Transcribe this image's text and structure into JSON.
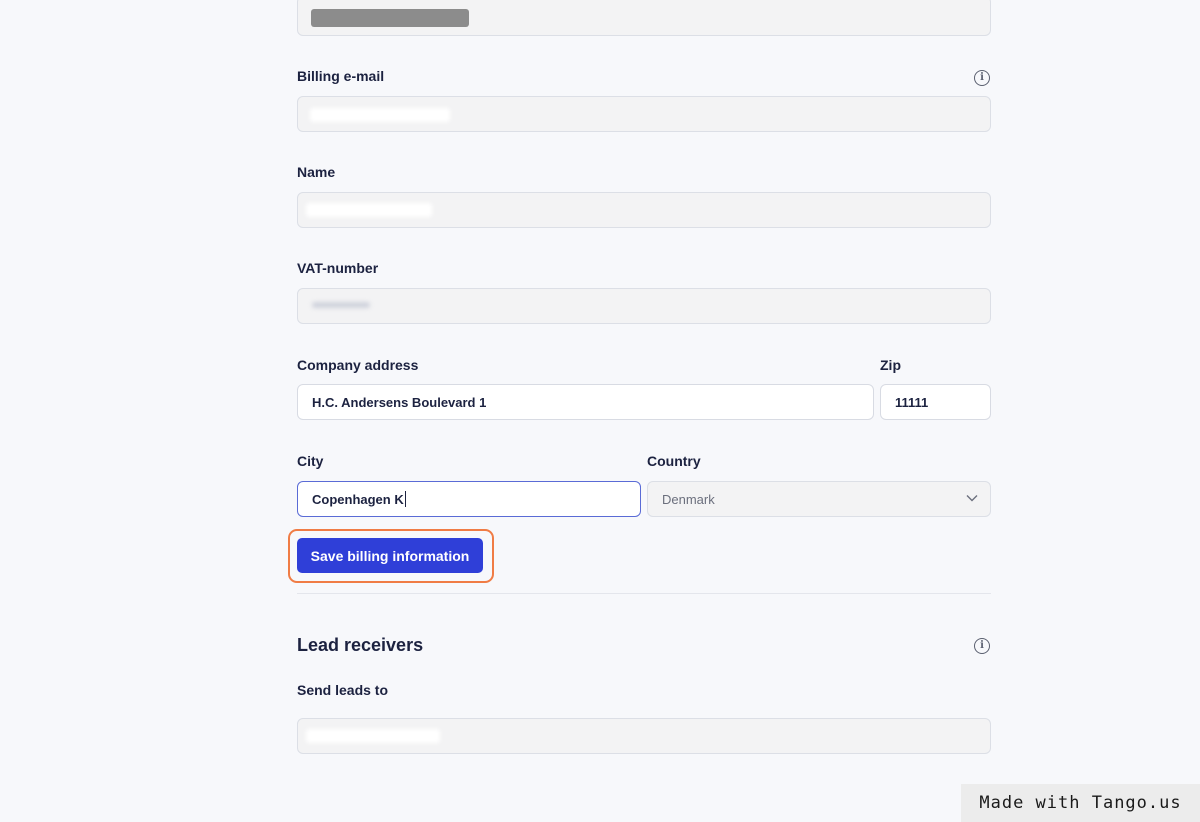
{
  "form": {
    "top_field": {
      "value": ""
    },
    "billing_email": {
      "label": "Billing e-mail",
      "value": ""
    },
    "name": {
      "label": "Name",
      "value": ""
    },
    "vat_number": {
      "label": "VAT-number",
      "value": ""
    },
    "company_address": {
      "label": "Company address",
      "value": "H.C. Andersens Boulevard 1"
    },
    "zip": {
      "label": "Zip",
      "value": "11111"
    },
    "city": {
      "label": "City",
      "value": "Copenhagen K"
    },
    "country": {
      "label": "Country",
      "value": "Denmark"
    },
    "save_label": "Save billing information"
  },
  "lead_receivers": {
    "title": "Lead receivers",
    "send_leads_label": "Send leads to",
    "send_leads_value": ""
  },
  "watermark": "Made with Tango.us",
  "colors": {
    "primary": "#2f3fd8",
    "highlight": "#f07c45",
    "focus_border": "#5a6bd6"
  }
}
